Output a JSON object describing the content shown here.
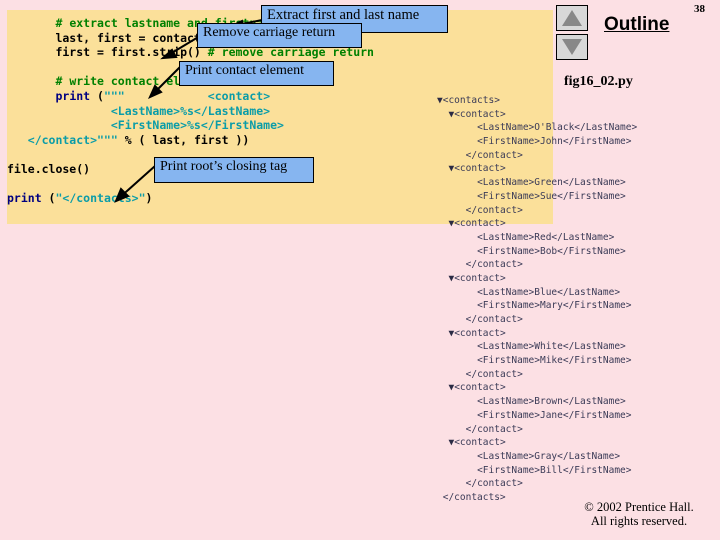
{
  "slide": {
    "page_number": "38",
    "outline_title": "Outline",
    "file_name": "fig16_02.py",
    "copyright_line1": "© 2002 Prentice Hall.",
    "copyright_line2": "All rights reserved."
  },
  "nav": {
    "up_icon": "triangle-up-icon",
    "down_icon": "triangle-down-icon"
  },
  "code": {
    "lines": [
      [
        {
          "t": "pln",
          "s": "       "
        },
        {
          "t": "cmt",
          "s": "# extract lastname and firstname"
        }
      ],
      [
        {
          "t": "pln",
          "s": "       last, first = contact.split( \",\" )"
        }
      ],
      [
        {
          "t": "pln",
          "s": "       first = first.strip() "
        },
        {
          "t": "cmt",
          "s": "# remove carriage return"
        }
      ],
      [
        {
          "t": "pln",
          "s": ""
        }
      ],
      [
        {
          "t": "pln",
          "s": "       "
        },
        {
          "t": "cmt",
          "s": "# write contact element"
        }
      ],
      [
        {
          "t": "pln",
          "s": "       "
        },
        {
          "t": "kw",
          "s": "print"
        },
        {
          "t": "pln",
          "s": " ("
        },
        {
          "t": "str",
          "s": "\"\"\"            <contact>"
        }
      ],
      [
        {
          "t": "str",
          "s": "               <LastName>%s</LastName>"
        }
      ],
      [
        {
          "t": "str",
          "s": "               <FirstName>%s</FirstName>"
        }
      ],
      [
        {
          "t": "str",
          "s": "   </contact>\"\"\""
        },
        {
          "t": "pln",
          "s": " % ( last, first ))"
        }
      ],
      [
        {
          "t": "pln",
          "s": ""
        }
      ],
      [
        {
          "t": "pln",
          "s": "file.close()"
        }
      ],
      [
        {
          "t": "pln",
          "s": ""
        }
      ],
      [
        {
          "t": "kw",
          "s": "print"
        },
        {
          "t": "pln",
          "s": " ("
        },
        {
          "t": "str",
          "s": "\"</contacts>\""
        },
        {
          "t": "pln",
          "s": ")"
        }
      ]
    ]
  },
  "callouts": [
    {
      "id": "extract",
      "label": "Extract first and last name"
    },
    {
      "id": "remove",
      "label": "Remove carriage return"
    },
    {
      "id": "print_ce",
      "label": "Print contact element"
    },
    {
      "id": "print_rc",
      "label": "Print root’s closing tag"
    }
  ],
  "outline_tree": {
    "rows": [
      {
        "indent": 0,
        "toggle": "▼",
        "text": "<contacts>"
      },
      {
        "indent": 1,
        "toggle": "▼",
        "text": "<contact>"
      },
      {
        "indent": 3,
        "toggle": "",
        "text": "<LastName>O'Black</LastName>"
      },
      {
        "indent": 3,
        "toggle": "",
        "text": "<FirstName>John</FirstName>"
      },
      {
        "indent": 2,
        "toggle": "",
        "text": "</contact>"
      },
      {
        "indent": 1,
        "toggle": "▼",
        "text": "<contact>"
      },
      {
        "indent": 3,
        "toggle": "",
        "text": "<LastName>Green</LastName>"
      },
      {
        "indent": 3,
        "toggle": "",
        "text": "<FirstName>Sue</FirstName>"
      },
      {
        "indent": 2,
        "toggle": "",
        "text": "</contact>"
      },
      {
        "indent": 1,
        "toggle": "▼",
        "text": "<contact>"
      },
      {
        "indent": 3,
        "toggle": "",
        "text": "<LastName>Red</LastName>"
      },
      {
        "indent": 3,
        "toggle": "",
        "text": "<FirstName>Bob</FirstName>"
      },
      {
        "indent": 2,
        "toggle": "",
        "text": "</contact>"
      },
      {
        "indent": 1,
        "toggle": "▼",
        "text": "<contact>"
      },
      {
        "indent": 3,
        "toggle": "",
        "text": "<LastName>Blue</LastName>"
      },
      {
        "indent": 3,
        "toggle": "",
        "text": "<FirstName>Mary</FirstName>"
      },
      {
        "indent": 2,
        "toggle": "",
        "text": "</contact>"
      },
      {
        "indent": 1,
        "toggle": "▼",
        "text": "<contact>"
      },
      {
        "indent": 3,
        "toggle": "",
        "text": "<LastName>White</LastName>"
      },
      {
        "indent": 3,
        "toggle": "",
        "text": "<FirstName>Mike</FirstName>"
      },
      {
        "indent": 2,
        "toggle": "",
        "text": "</contact>"
      },
      {
        "indent": 1,
        "toggle": "▼",
        "text": "<contact>"
      },
      {
        "indent": 3,
        "toggle": "",
        "text": "<LastName>Brown</LastName>"
      },
      {
        "indent": 3,
        "toggle": "",
        "text": "<FirstName>Jane</FirstName>"
      },
      {
        "indent": 2,
        "toggle": "",
        "text": "</contact>"
      },
      {
        "indent": 1,
        "toggle": "▼",
        "text": "<contact>"
      },
      {
        "indent": 3,
        "toggle": "",
        "text": "<LastName>Gray</LastName>"
      },
      {
        "indent": 3,
        "toggle": "",
        "text": "<FirstName>Bill</FirstName>"
      },
      {
        "indent": 2,
        "toggle": "",
        "text": "</contact>"
      },
      {
        "indent": 0,
        "toggle": "",
        "text": "</contacts>"
      }
    ]
  },
  "colors": {
    "background": "#fce0e4",
    "code_panel": "#fbe09a",
    "callout_fill": "#86b5f0",
    "comment": "#008000",
    "keyword": "#000080",
    "string": "#0b9ca8"
  }
}
